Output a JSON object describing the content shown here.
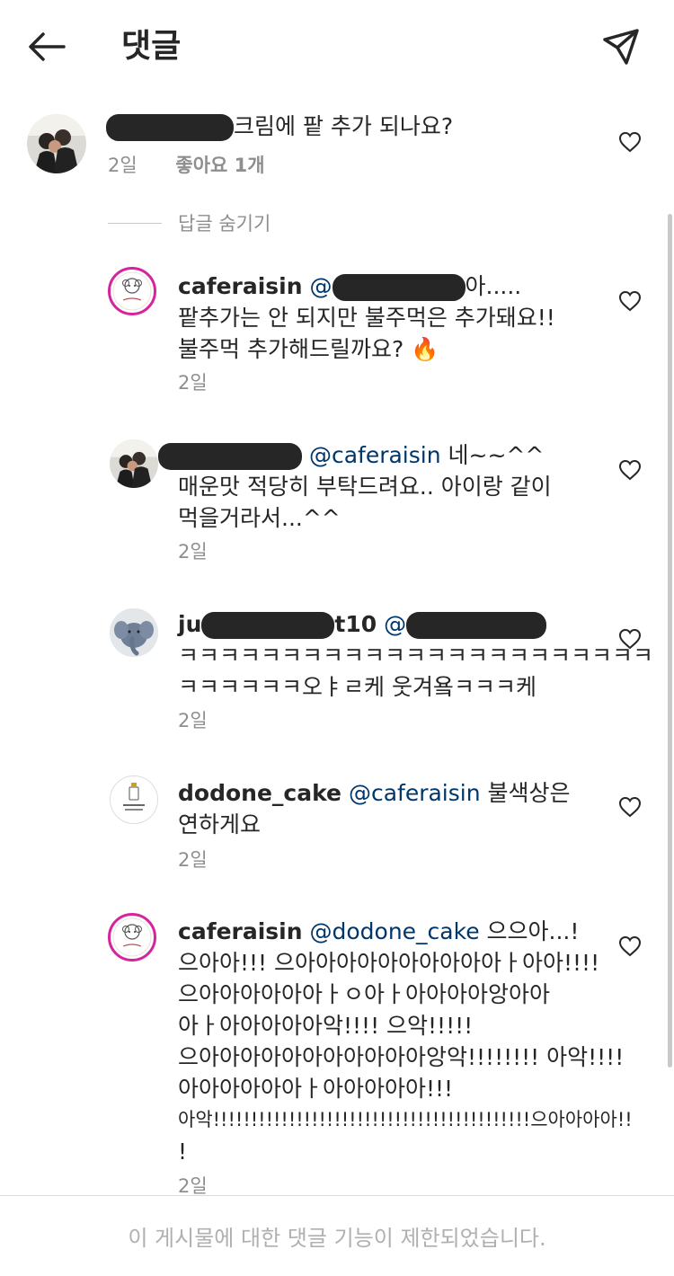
{
  "header": {
    "title": "댓글"
  },
  "comments": [
    {
      "text": "크림에 팥 추가 되나요?",
      "time": "2일",
      "likes": "좋아요 1개"
    }
  ],
  "hide_replies": "답글 숨기기",
  "replies": [
    {
      "username": "caferaisin",
      "mention_suffix": "아.....",
      "lines": [
        "팥추가는 안 되지만 불주먹은 추가돼요!!",
        "불주먹 추가해드릴까요? 🔥"
      ],
      "time": "2일"
    },
    {
      "mention": "@caferaisin",
      "text_first": " 네~~^^",
      "lines": [
        "매운맛 적당히 부탁드려요.. 아이랑 같이",
        "먹을거라서...^^"
      ],
      "time": "2일"
    },
    {
      "username_prefix": "ju",
      "username_suffix": "t10",
      "mention_prefix": " @",
      "lines": [
        "ㅋㅋㅋㅋㅋㅋㅋㅋㅋㅋㅋㅋㅋㅋㅋㅋㅋㅋㅋㅋㅋㅋㅋ",
        "ㅋㅋㅋㅋㅋㅋ오ㅑㄹ케 웃겨욬ㅋㅋㅋ케"
      ],
      "time": "2일"
    },
    {
      "username": "dodone_cake",
      "mention": "@caferaisin",
      "text_first": " 불색상은",
      "lines": [
        "연하게요"
      ],
      "time": "2일"
    },
    {
      "username": "caferaisin",
      "mention": "@dodone_cake",
      "text_first": " 으으아...!",
      "lines": [
        "으아아!!! 으아아아아아아아아아아ㅏ아아!!!!",
        "으아아아아아아ㅏㅇ아ㅏ아아아아앙아아",
        "아ㅏ아아아아아악!!!! 으악!!!!!",
        "으아아아아아아아아아아아앙악!!!!!!!! 아악!!!!",
        "아아아아아아ㅏ아아아아아!!!",
        "아악!!!!!!!!!!!!!!!!!!!!!!!!!!!!!!!!!!!!!!!!!!으아아아아!!",
        "!"
      ],
      "time": "2일"
    }
  ],
  "footer": {
    "notice": "이 게시물에 대한 댓글 기능이 제한되었습니다."
  },
  "colors": {
    "text": "#262626",
    "meta": "#8e8e8e",
    "mention": "#00376b",
    "avatar_ring": "#d6249f"
  }
}
